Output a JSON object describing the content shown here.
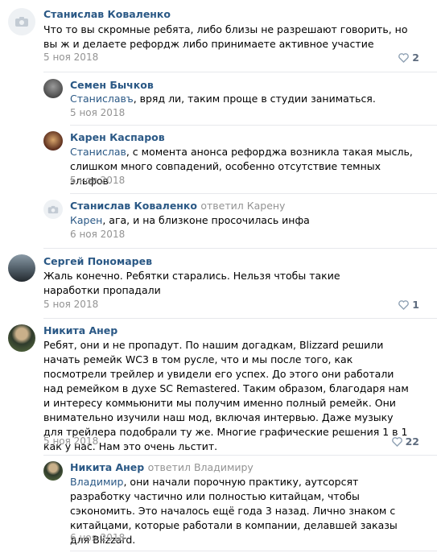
{
  "comments": [
    {
      "author": "Станислав Коваленко",
      "text": "Что то вы скромные ребята, либо близы не разрешают говорить, но вы ж и делаете рефордж либо принимаете активное участие",
      "date": "5 ноя 2018",
      "likes": "2"
    },
    {
      "author": "Семен Бычков",
      "mention": "Станиславъ",
      "text": ", вряд ли, таким проще в студии заниматься.",
      "date": "5 ноя 2018"
    },
    {
      "author": "Карен Каспаров",
      "mention": "Станислав",
      "text": ", с момента анонса рефорджа возникла такая мысль, слишком много совпадений, особенно отсутствие темных эльфов",
      "date": "5 ноя 2018"
    },
    {
      "author": "Станислав Коваленко",
      "reply_to": "ответил Карену",
      "mention": "Карен",
      "text": ", ага, и на близконе просочилась инфа",
      "date": "6 ноя 2018"
    },
    {
      "author": "Сергей Пономарев",
      "text": "Жаль конечно. Ребятки старались. Нельзя чтобы такие наработки пропадали",
      "date": "5 ноя 2018",
      "likes": "1"
    },
    {
      "author": "Никита Анер",
      "text": "Ребят, они и не пропадут. По нашим догадкам, Blizzard решили начать ремейк WC3 в том русле, что и мы после того, как посмотрели трейлер и увидели его успех. До этого они работали над ремейком в духе SC Remastered. Таким образом, благодаря нам и интересу коммьюнити мы получим именно полный ремейк. Они внимательно изучили наш мод, включая интервью. Даже музыку для трейлера подобрали ту же. Многие графические решения 1 в 1 как у нас. Нам это очень льстит.",
      "date": "5 ноя 2018",
      "likes": "22"
    },
    {
      "author": "Никита Анер",
      "reply_to": "ответил Владимиру",
      "mention": "Владимир",
      "text": ", они начали порочную практику, аутсорсят разработку частично или полностью китайцам, чтобы сэкономить. Это началось ещё года 3 назад. Лично знаком с китайцами, которые работали в компании, делавшей заказы для Blizzard.",
      "date": "6 ноя 2018"
    }
  ],
  "colors": {
    "link": "#2a5885",
    "meta": "#939393",
    "divider": "#e7e8ec"
  }
}
